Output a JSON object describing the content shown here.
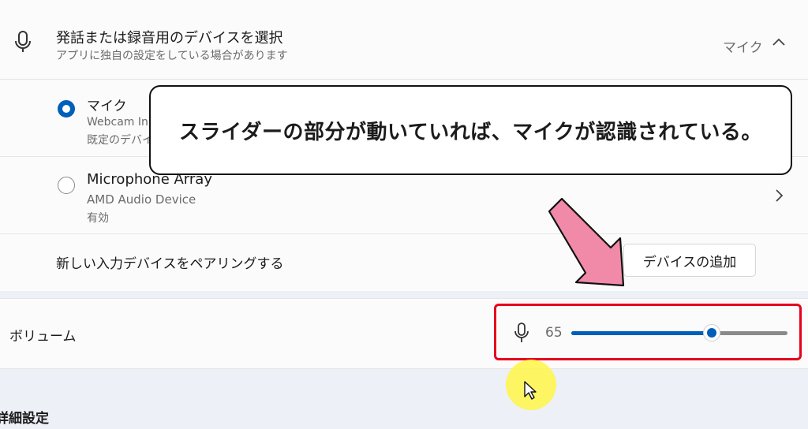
{
  "input_device": {
    "title": "発話または録音用のデバイスを選択",
    "subtitle": "アプリに独自の設定をしている場合があります",
    "selected_value": "マイク"
  },
  "devices": [
    {
      "name": "マイク",
      "detail": "Webcam In",
      "status": "既定のデバイ",
      "selected": true
    },
    {
      "name": "Microphone Array",
      "detail": "AMD Audio Device",
      "status": "有効",
      "selected": false
    }
  ],
  "pair": {
    "label": "新しい入力デバイスをペアリングする",
    "button": "デバイスの追加"
  },
  "volume": {
    "label": "ボリューム",
    "value_text": "65",
    "level": 0.65
  },
  "advanced": {
    "heading": "詳細設定"
  },
  "annotation": {
    "callout": "スライダーの部分が動いていれば、マイクが認識されている。"
  },
  "colors": {
    "accent": "#005fb8",
    "highlight": "#e6001e",
    "arrow": "#f08aa8",
    "cursor_glow": "#fff646"
  },
  "icons": [
    "microphone-icon",
    "chevron-up-icon",
    "chevron-right-icon",
    "cursor-icon"
  ]
}
